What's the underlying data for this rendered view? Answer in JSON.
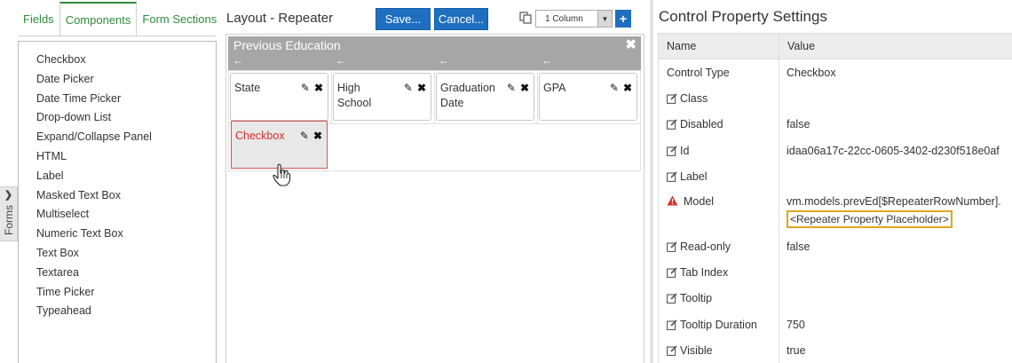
{
  "left": {
    "forms_tab_label": "Forms",
    "tabs": [
      {
        "label": "Fields"
      },
      {
        "label": "Components"
      },
      {
        "label": "Form Sections"
      }
    ],
    "components": [
      "Checkbox",
      "Date Picker",
      "Date Time Picker",
      "Drop-down List",
      "Expand/Collapse Panel",
      "HTML",
      "Label",
      "Masked Text Box",
      "Multiselect",
      "Numeric Text Box",
      "Text Box",
      "Textarea",
      "Time Picker",
      "Typeahead"
    ]
  },
  "middle": {
    "title": "Layout - Repeater",
    "save_label": "Save...",
    "cancel_label": "Cancel...",
    "column_select_value": "1 Column",
    "plus_label": "+",
    "repeater": {
      "title": "Previous Education",
      "close_glyph": "✖",
      "arrow_glyph": "←"
    },
    "fields": [
      {
        "line1": "State",
        "line2": ""
      },
      {
        "line1": "High",
        "line2": "School"
      },
      {
        "line1": "Graduation",
        "line2": "Date"
      },
      {
        "line1": "GPA",
        "line2": ""
      }
    ],
    "selected_field": {
      "label": "Checkbox"
    },
    "pencil_glyph": "✎",
    "x_glyph": "✖"
  },
  "right": {
    "title": "Control Property Settings",
    "headers": {
      "name": "Name",
      "value": "Value"
    },
    "control_type": {
      "name": "Control Type",
      "value": "Checkbox"
    },
    "rows": [
      {
        "name": "Class",
        "value": ""
      },
      {
        "name": "Disabled",
        "value": "false"
      },
      {
        "name": "Id",
        "value": "idaa06a17c-22cc-0605-3402-d230f518e0af"
      },
      {
        "name": "Label",
        "value": ""
      }
    ],
    "model": {
      "name": "Model",
      "value": "vm.models.prevEd[$RepeaterRowNumber].",
      "placeholder": "<Repeater Property Placeholder>"
    },
    "rows2": [
      {
        "name": "Read-only",
        "value": "false"
      },
      {
        "name": "Tab Index",
        "value": ""
      },
      {
        "name": "Tooltip",
        "value": ""
      },
      {
        "name": "Tooltip Duration",
        "value": "750"
      },
      {
        "name": "Visible",
        "value": "true"
      }
    ]
  },
  "colors": {
    "accent_green": "#2e8b3a",
    "button_blue": "#1f6fc1",
    "selected_red": "#d9302a",
    "placeholder_border": "#e3a51e"
  }
}
